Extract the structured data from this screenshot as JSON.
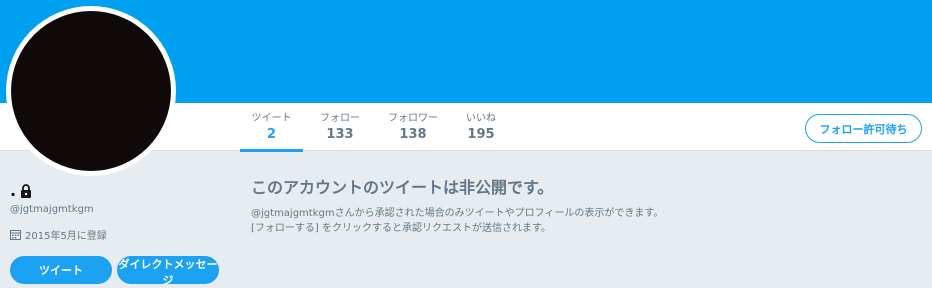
{
  "profile": {
    "display_name": ".",
    "screen_name": "@jgtmajgmtkgm",
    "joined": "2015年5月に登録"
  },
  "nav": {
    "stats": [
      {
        "label": "ツイート",
        "value": "2"
      },
      {
        "label": "フォロー",
        "value": "133"
      },
      {
        "label": "フォロワー",
        "value": "138"
      },
      {
        "label": "いいね",
        "value": "195"
      }
    ],
    "follow_request_label": "フォロー許可待ち"
  },
  "actions": {
    "tweet_label": "ツイート",
    "dm_label": "ダイレクトメッセージ"
  },
  "private_notice": {
    "title": "このアカウントのツイートは非公開です。",
    "line1": "@jgtmajgmtkgmさんから承認された場合のみツイートやプロフィールの表示ができます。",
    "line2": "[フォローする] をクリックすると承認リクエストが送信されます。"
  },
  "colors": {
    "banner": "#00a0f0",
    "accent": "#1da1f2",
    "background": "#e6ecf0",
    "avatar": "#0f0909"
  },
  "icons": [
    "lock-icon",
    "calendar-icon"
  ]
}
